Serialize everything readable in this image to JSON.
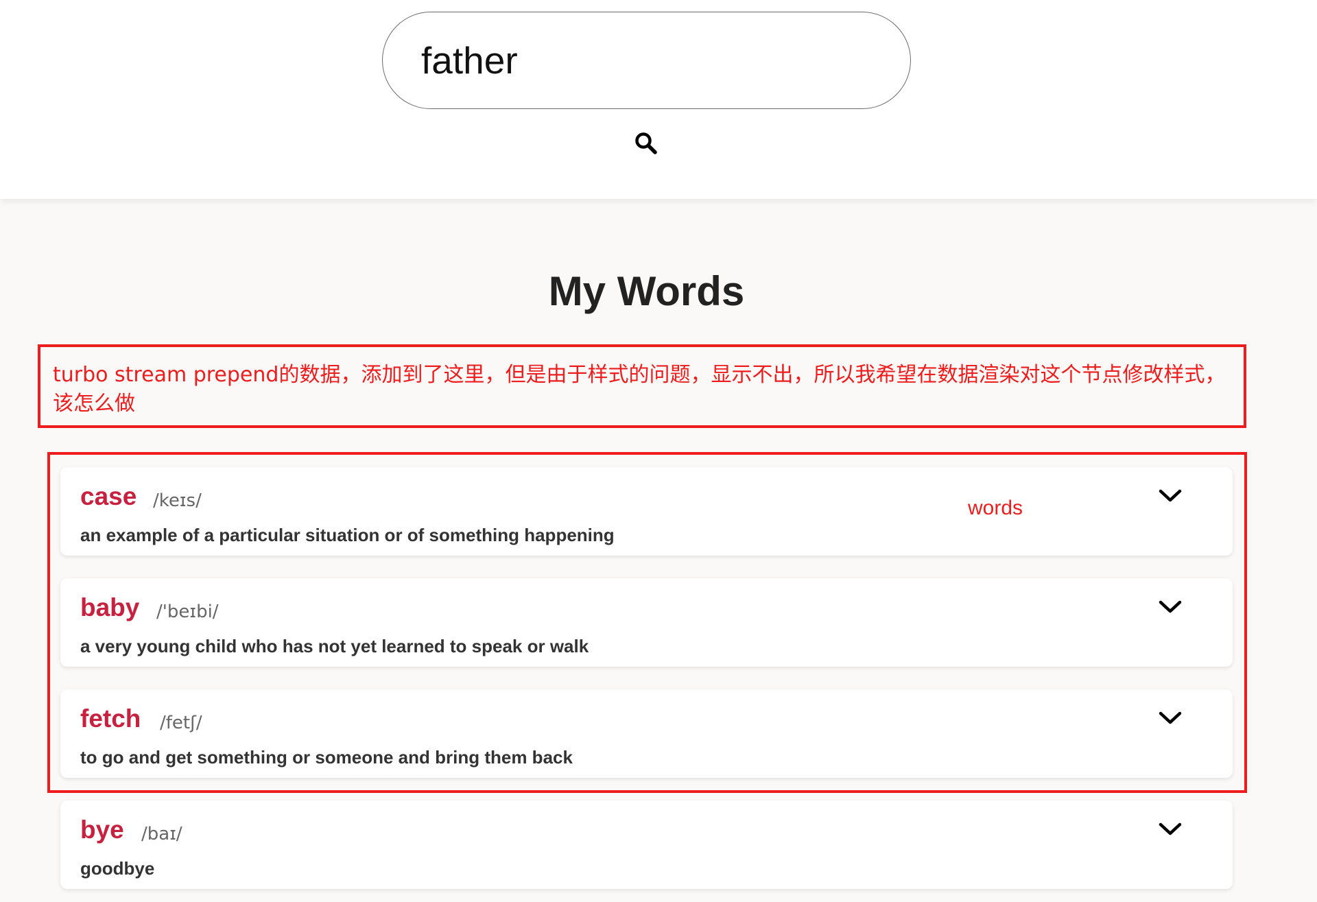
{
  "search": {
    "value": "father"
  },
  "icons": {
    "search": "search-icon",
    "expand": "chevron-down-icon"
  },
  "title": "My Words",
  "annotations": {
    "note": "turbo stream prepend的数据，添加到了这里，但是由于样式的问题，显示不出，所以我希望在数据渲染对这个节点修改样式，该怎么做",
    "words_label": "words"
  },
  "words": [
    {
      "word": "case",
      "phonetic": "/keɪs/",
      "definition": "an example of a particular situation or of something happening"
    },
    {
      "word": "baby",
      "phonetic": "/'beɪbi/",
      "definition": "a very young child who has not yet learned to speak or walk"
    },
    {
      "word": "fetch",
      "phonetic": "/fetʃ/",
      "definition": "to go and get something or someone and bring them back"
    },
    {
      "word": "bye",
      "phonetic": "/baɪ/",
      "definition": "goodbye"
    }
  ],
  "colors": {
    "accent": "#c8203f",
    "annotation": "#ee1c1c",
    "background": "#fbf9f7"
  }
}
